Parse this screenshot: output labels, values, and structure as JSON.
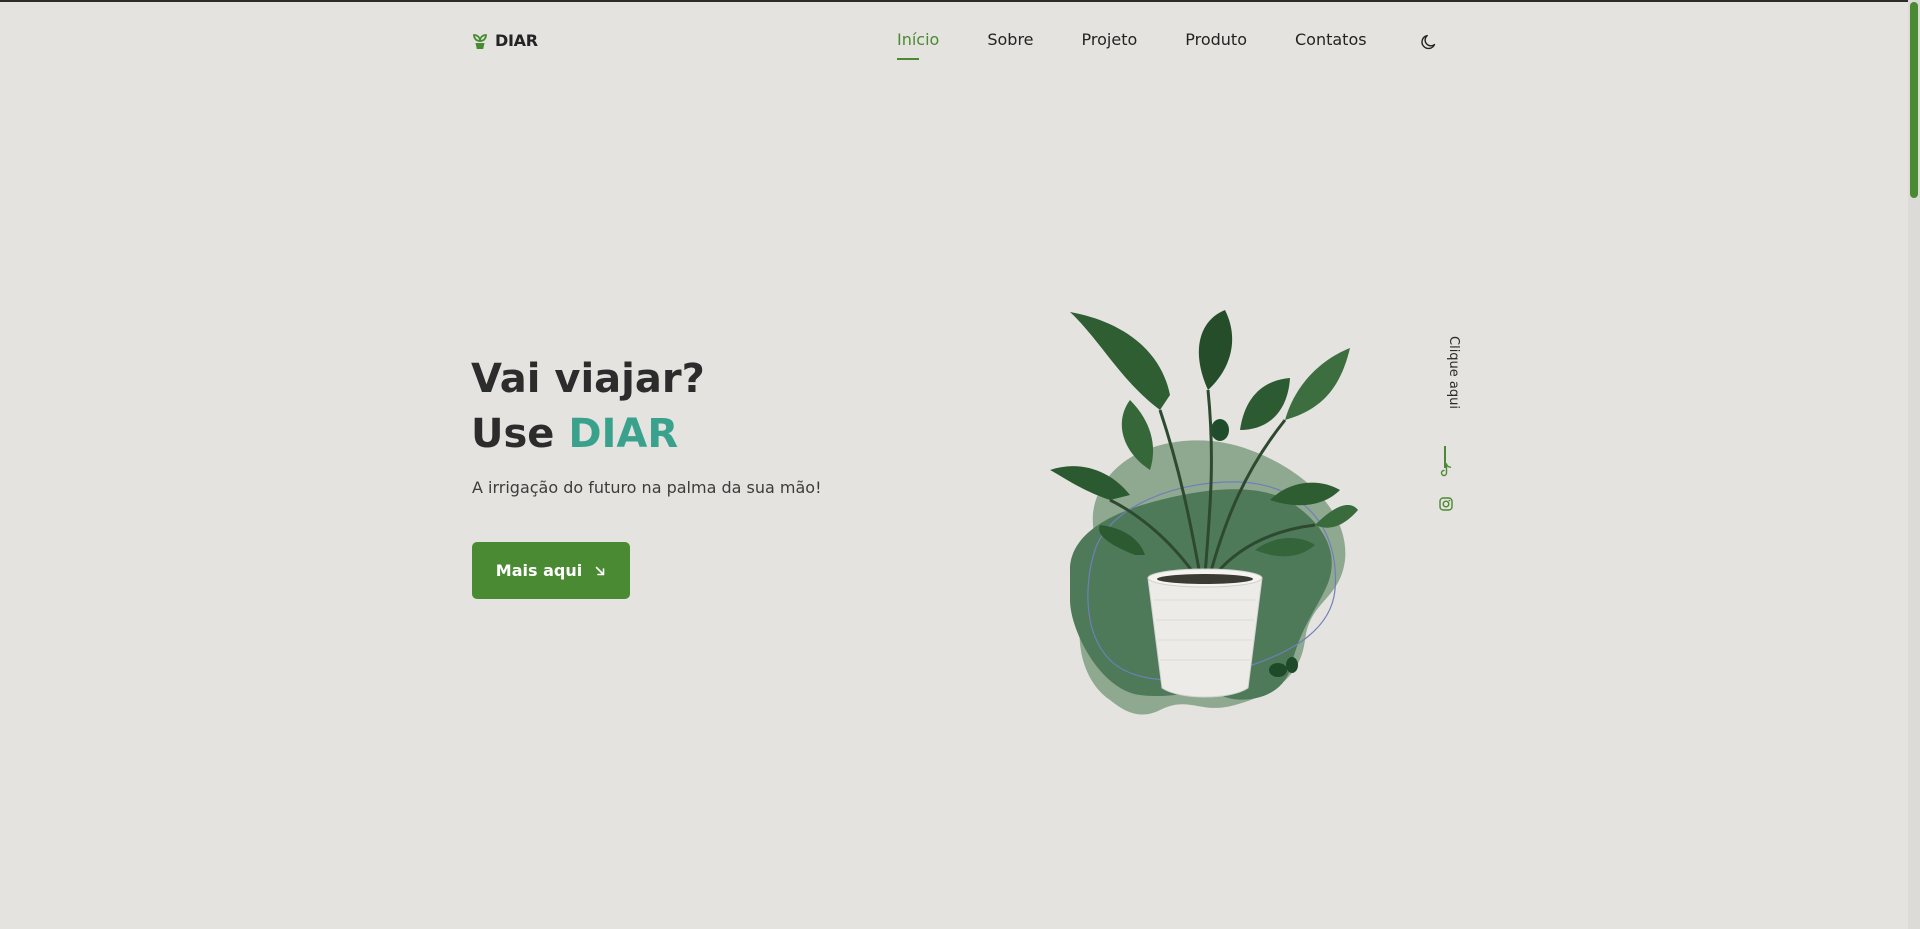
{
  "brand": {
    "name": "DIAR",
    "icon": "plant-sprout-icon",
    "accent_color": "#4a8a32",
    "highlight_color": "#3aa28c"
  },
  "nav": {
    "items": [
      {
        "label": "Início",
        "active": true
      },
      {
        "label": "Sobre",
        "active": false
      },
      {
        "label": "Projeto",
        "active": false
      },
      {
        "label": "Produto",
        "active": false
      },
      {
        "label": "Contatos",
        "active": false
      }
    ],
    "theme_toggle_icon": "moon-icon"
  },
  "hero": {
    "title_line1": "Vai viajar?",
    "title_line2_prefix": "Use ",
    "title_line2_accent": "DIAR",
    "subtitle": "A irrigação do futuro na palma da sua mão!",
    "cta_label": "Mais aqui",
    "cta_icon": "arrow-down-right-icon",
    "image": "potted-plant-illustration"
  },
  "social": {
    "label": "Clique aqui",
    "icons": [
      "tiktok-icon",
      "instagram-icon"
    ]
  }
}
